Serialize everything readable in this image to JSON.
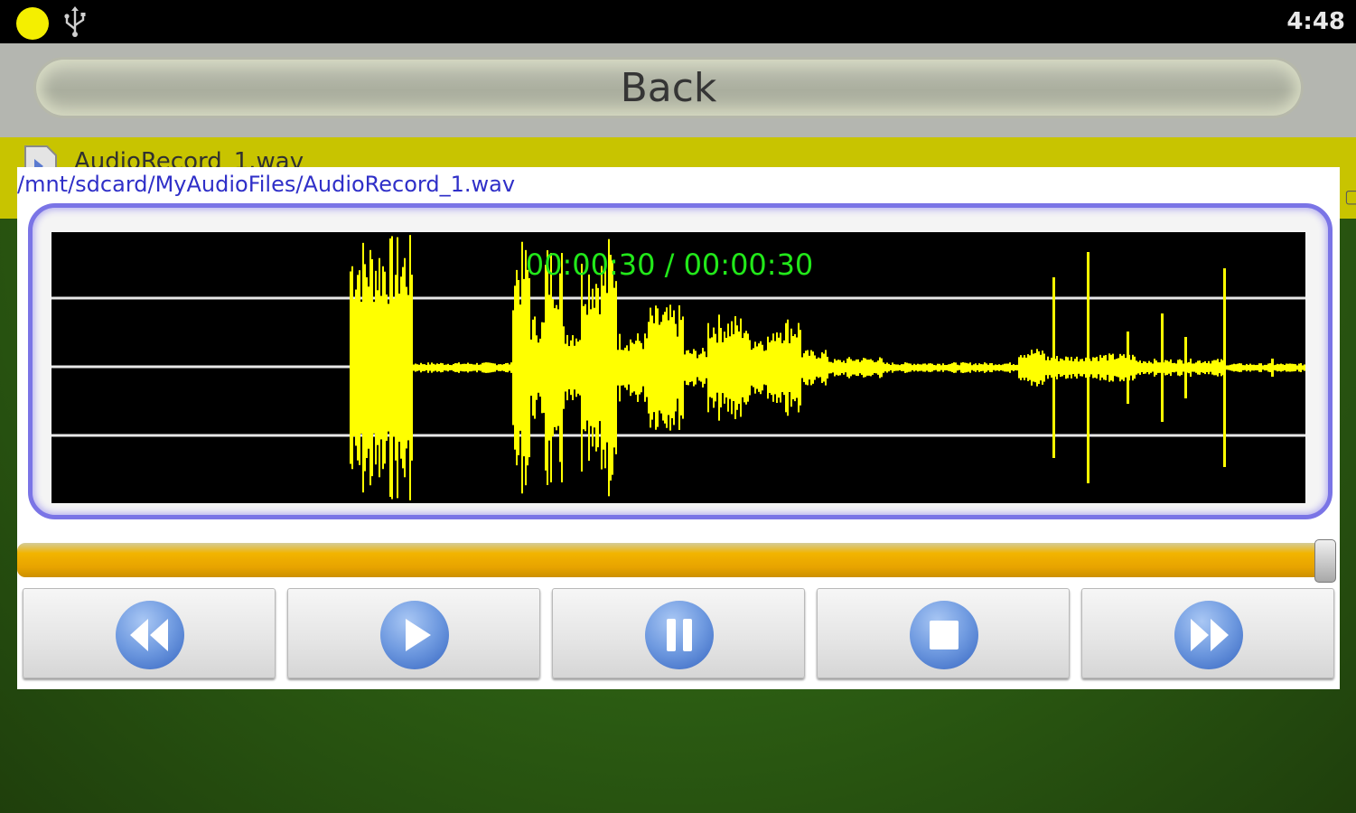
{
  "status_bar": {
    "time": "4:48",
    "icons": [
      "notification-dot",
      "usb-icon"
    ],
    "notification_color": "#f4ef00"
  },
  "header": {
    "back_label": "Back"
  },
  "file_list": {
    "items": [
      {
        "name": "AudioRecord_1.wav",
        "icon": "audio-file-icon"
      }
    ],
    "highlight_color": "#c8c400"
  },
  "player": {
    "file_path": "/mnt/sdcard/MyAudioFiles/AudioRecord_1.wav",
    "time_display": "00:00:30 / 00:00:30",
    "progress_fraction": 1.0,
    "waveform_color": "#ffff00",
    "time_color": "#22e81a",
    "frame_color": "#7a74e6",
    "progress_color": "#f2b400",
    "controls": [
      {
        "name": "rewind",
        "icon": "rewind-icon"
      },
      {
        "name": "play",
        "icon": "play-icon"
      },
      {
        "name": "pause",
        "icon": "pause-icon"
      },
      {
        "name": "stop",
        "icon": "stop-icon"
      },
      {
        "name": "fast-forward",
        "icon": "fast-forward-icon"
      }
    ]
  }
}
